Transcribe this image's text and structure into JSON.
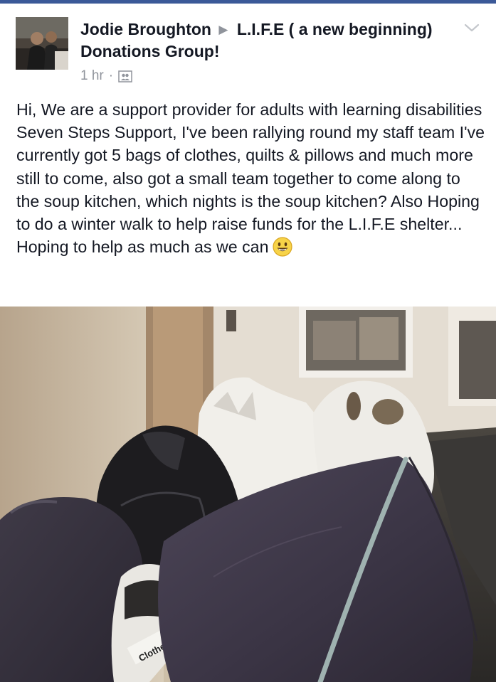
{
  "post": {
    "author": "Jodie Broughton",
    "group": "L.I.F.E ( a new beginning) Donations Group!",
    "timestamp": "1 hr",
    "separator": "·",
    "audience_icon": "group-members-icon",
    "menu_icon": "chevron-down-icon",
    "text": "Hi, We are a support provider for adults with learning disabilities Seven Steps Support, I've been rallying round my staff team I've currently got 5 bags of clothes, quilts & pillows and much more still to come, also got a small team together to come along to the soup kitchen, which nights is the soup kitchen? Also Hoping to do a winter walk to help raise funds for the L.I.F.E shelter... Hoping to help as much as we can",
    "emoji": "smiley-emoji"
  },
  "photo": {
    "bag_label": "Clothes Aid"
  },
  "colors": {
    "brand_bar": "#3b5998",
    "name_text": "#141823",
    "meta_text": "#90949c",
    "emoji_yellow": "#f7d348"
  }
}
